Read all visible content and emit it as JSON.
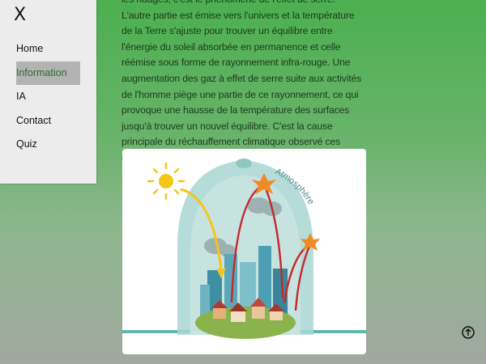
{
  "main": {
    "paragraph": "les nuages, c'est le phénomène de l'effet de serre. L'autre partie est émise vers l'univers et la température de la Terre s'ajuste pour trouver un équilibre entre l'énergie du soleil absorbée en permanence et celle réémise sous forme de rayonnement infra-rouge. Une augmentation des gaz à effet de serre suite aux activités de l'homme piège une partie de ce rayonnement, ce qui provoque une hausse de la température des surfaces jusqu'à trouver un nouvel équilibre. C'est la cause principale du réchauffement climatique observé ces dernières décennies."
  },
  "figure": {
    "atmosphere_label": "Atmosphère"
  },
  "sidebar": {
    "close_label": "X",
    "items": [
      {
        "label": "Home"
      },
      {
        "label": "Information",
        "active": true
      },
      {
        "label": "IA"
      },
      {
        "label": "Contact"
      },
      {
        "label": "Quiz"
      }
    ]
  },
  "colors": {
    "active_bg": "#b3b3b3",
    "active_text": "#2e6b2e",
    "sun": "#f5c518",
    "heat_arrow": "#c62828"
  },
  "icons": {
    "scroll_top": "arrow-up-circle-icon",
    "close": "close-icon"
  }
}
